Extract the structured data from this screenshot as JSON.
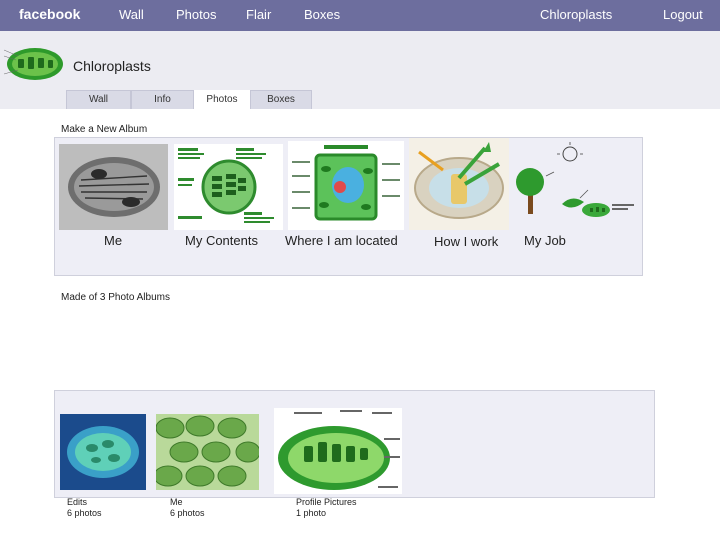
{
  "topbar": {
    "brand": "facebook",
    "nav": [
      "Wall",
      "Photos",
      "Flair",
      "Boxes"
    ],
    "profile_link": "Chloroplasts",
    "logout": "Logout"
  },
  "profile": {
    "name": "Chloroplasts",
    "tabs": [
      "Wall",
      "Info",
      "Photos",
      "Boxes"
    ],
    "active_tab": "Photos"
  },
  "new_album": {
    "label": "Make a New Album",
    "albums": [
      {
        "caption": "Me",
        "icon": "chloroplast-micrograph-image"
      },
      {
        "caption": "My  Contents",
        "icon": "chloroplast-diagram-image"
      },
      {
        "caption": "Where I am located",
        "icon": "plant-cell-image"
      },
      {
        "caption": "How I work",
        "icon": "photosynthesis-diagram-image"
      },
      {
        "caption": "My Job",
        "icon": "tree-leaf-sun-image"
      }
    ]
  },
  "made_of": {
    "label": "Made of 3 Photo Albums",
    "albums": [
      {
        "title": "Edits",
        "count": "6 photos",
        "icon": "blue-chloroplast-image"
      },
      {
        "title": "Me",
        "count": "6 photos",
        "icon": "green-cells-image"
      },
      {
        "title": "Profile Pictures",
        "count": "1 photo",
        "icon": "chloroplast-cutaway-image"
      }
    ]
  },
  "colors": {
    "topbar": "#6d6e9e",
    "header_bg": "#ececf2",
    "panel_bg": "#eeeef6"
  }
}
